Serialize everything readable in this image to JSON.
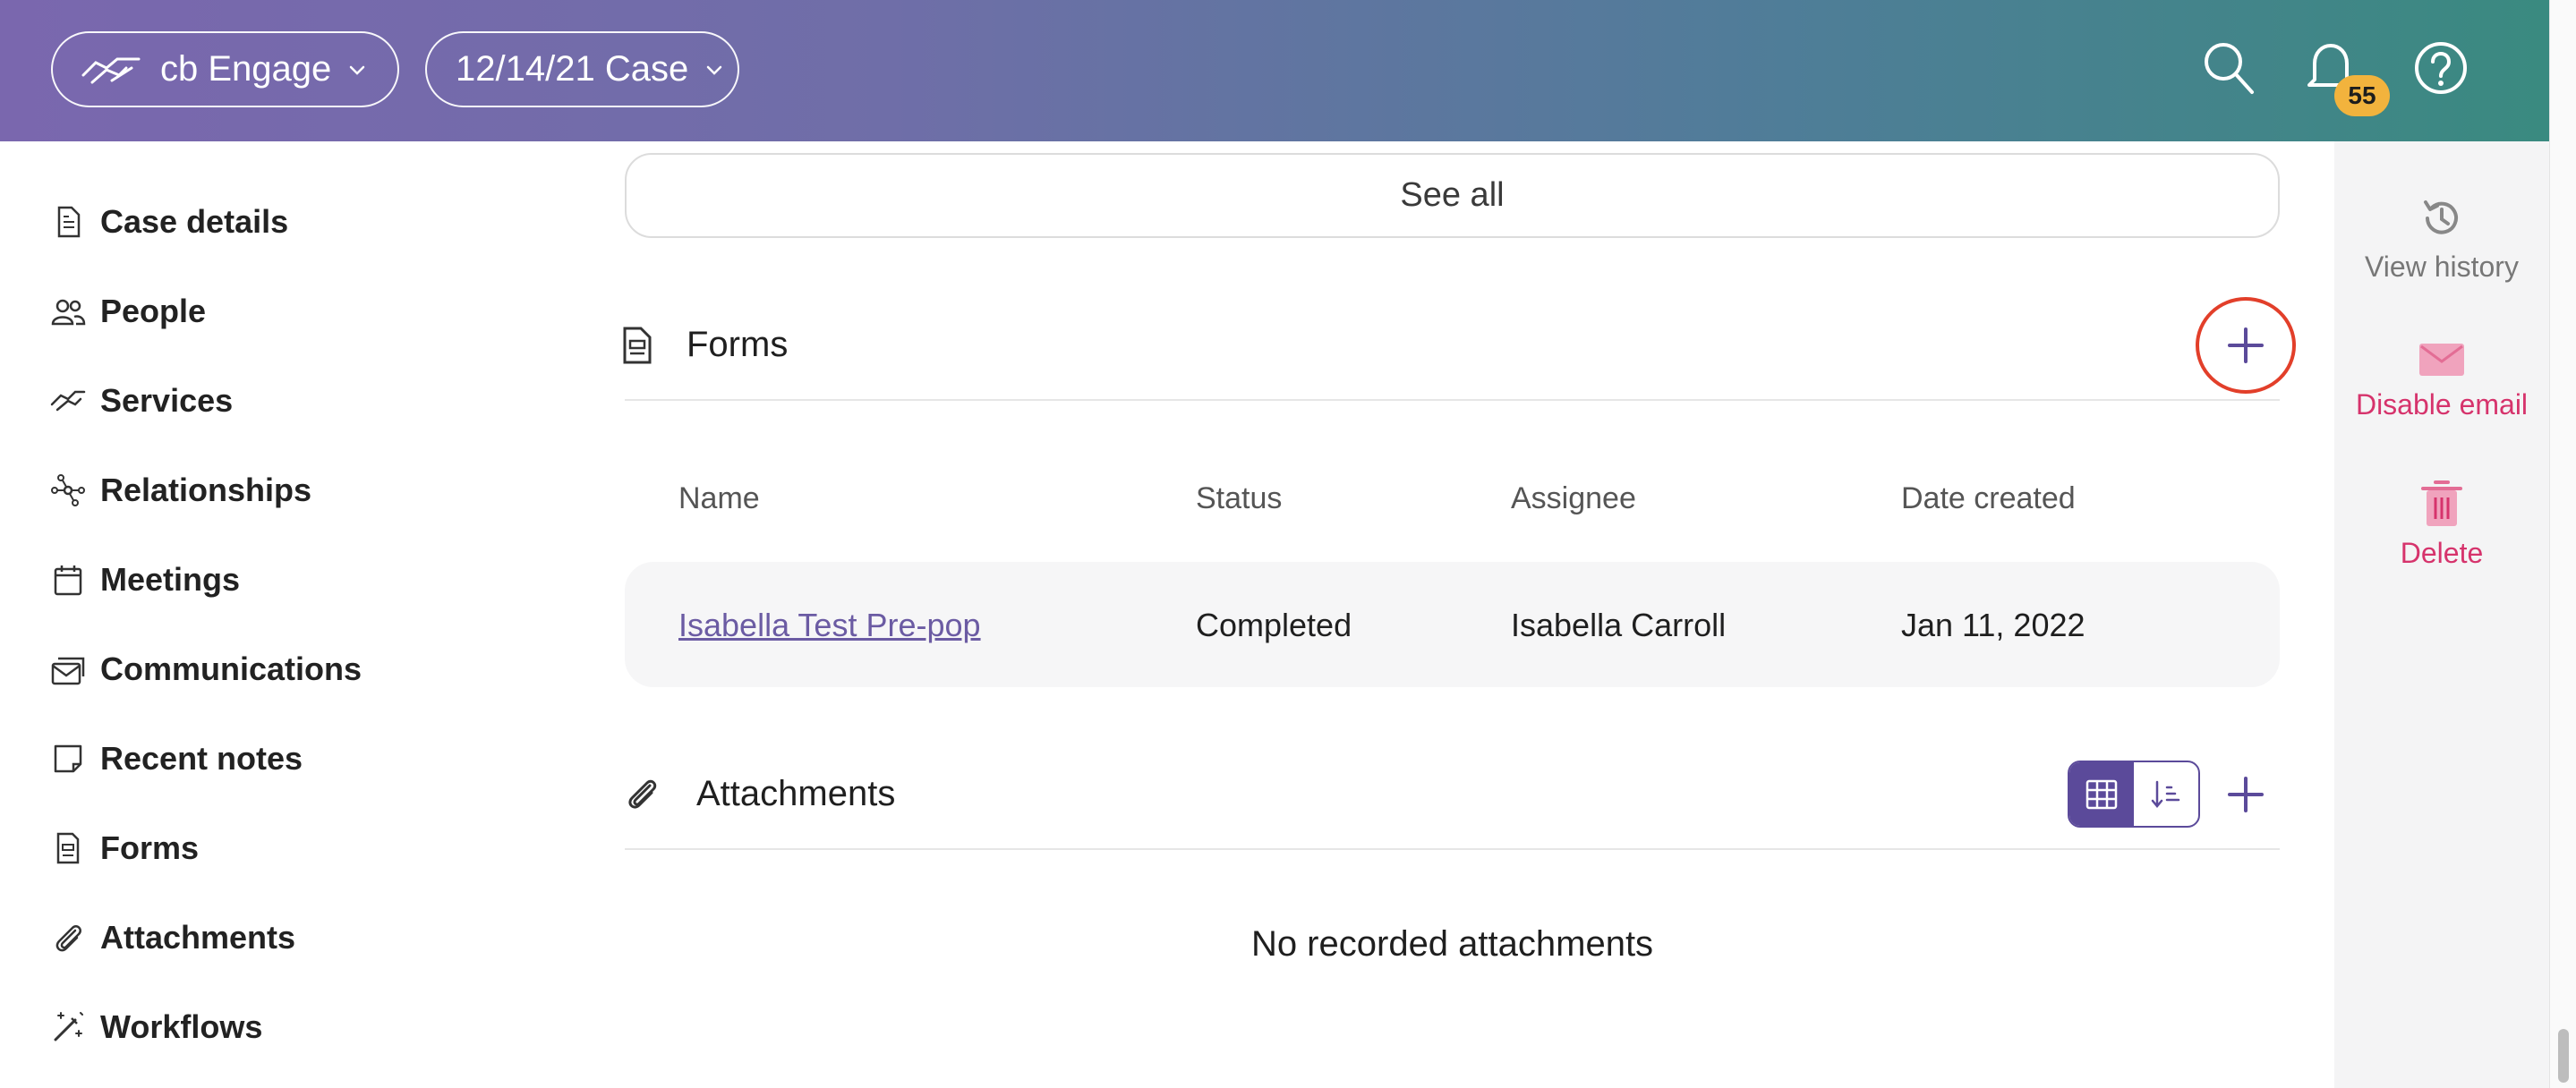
{
  "header": {
    "app_label": "cb Engage",
    "case_label": "12/14/21 Case",
    "notification_count": "55"
  },
  "sidebar": {
    "items": [
      {
        "label": "Case details",
        "icon": "document-icon"
      },
      {
        "label": "People",
        "icon": "people-icon"
      },
      {
        "label": "Services",
        "icon": "handshake-icon"
      },
      {
        "label": "Relationships",
        "icon": "network-icon"
      },
      {
        "label": "Meetings",
        "icon": "calendar-icon"
      },
      {
        "label": "Communications",
        "icon": "mail-stack-icon"
      },
      {
        "label": "Recent notes",
        "icon": "note-icon"
      },
      {
        "label": "Forms",
        "icon": "form-icon"
      },
      {
        "label": "Attachments",
        "icon": "paperclip-icon"
      },
      {
        "label": "Workflows",
        "icon": "magic-wand-icon"
      }
    ]
  },
  "main": {
    "see_all_label": "See all",
    "forms": {
      "title": "Forms",
      "columns": [
        "Name",
        "Status",
        "Assignee",
        "Date created"
      ],
      "rows": [
        {
          "name": "Isabella Test Pre-pop",
          "status": "Completed",
          "assignee": "Isabella Carroll",
          "date_created": "Jan 11, 2022"
        }
      ]
    },
    "attachments": {
      "title": "Attachments",
      "empty_text": "No recorded attachments"
    }
  },
  "rail": {
    "view_history": "View history",
    "disable_email": "Disable email",
    "delete": "Delete"
  },
  "colors": {
    "accent": "#5b4a9a",
    "danger": "#d6336c",
    "highlight_ring": "#e23f2a",
    "badge": "#f2b33d"
  }
}
